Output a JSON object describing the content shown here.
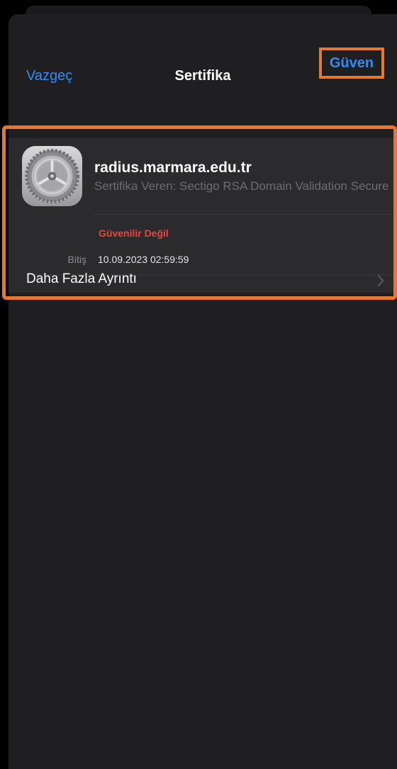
{
  "nav": {
    "cancel_label": "Vazgeç",
    "title": "Sertifika",
    "trust_label": "Güven"
  },
  "certificate": {
    "icon": "settings-gear-icon",
    "name": "radius.marmara.edu.tr",
    "issuer": "Sertifika Veren: Sectigo RSA Domain Validation Secure Server CA",
    "status": "Güvenilir Değil",
    "expiry_label": "Bitiş",
    "expiry_value": "10.09.2023 02:59:59",
    "details_label": "Daha Fazla Ayrıntı"
  },
  "colors": {
    "accent": "#2f8cf5",
    "warning": "#e6473f",
    "highlight": "#e8782e"
  }
}
